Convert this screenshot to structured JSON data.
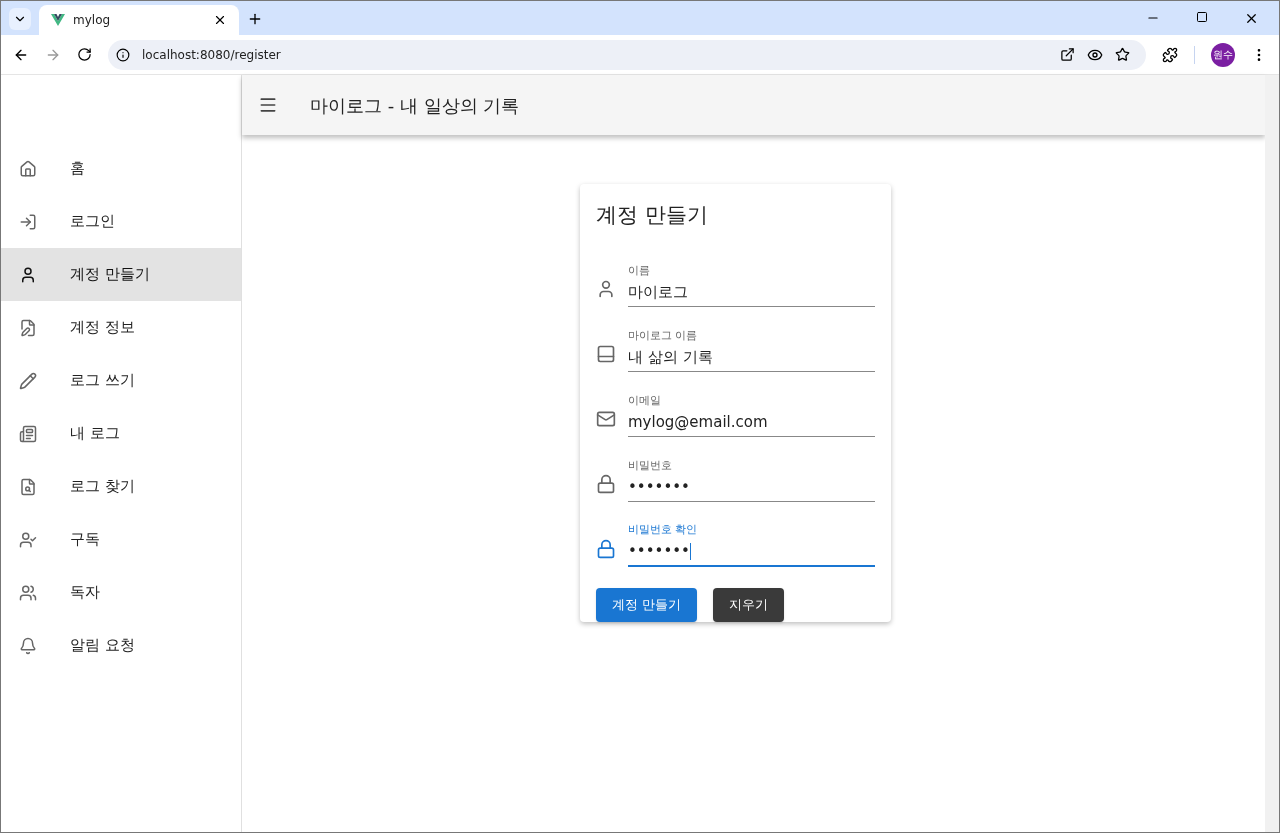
{
  "browser": {
    "tab": {
      "title": "mylog"
    },
    "url": "localhost:8080/register",
    "profile": "원수"
  },
  "app_bar": {
    "title": "마이로그 - 내 일상의 기록"
  },
  "sidebar": {
    "items": [
      {
        "label": "홈",
        "selected": false
      },
      {
        "label": "로그인",
        "selected": false
      },
      {
        "label": "계정 만들기",
        "selected": true
      },
      {
        "label": "계정 정보",
        "selected": false
      },
      {
        "label": "로그 쓰기",
        "selected": false
      },
      {
        "label": "내 로그",
        "selected": false
      },
      {
        "label": "로그 찾기",
        "selected": false
      },
      {
        "label": "구독",
        "selected": false
      },
      {
        "label": "독자",
        "selected": false
      },
      {
        "label": "알림 요청",
        "selected": false
      }
    ]
  },
  "form": {
    "title": "계정 만들기",
    "fields": [
      {
        "label": "이름",
        "value": "마이로그",
        "focused": false
      },
      {
        "label": "마이로그 이름",
        "value": "내 삶의 기록",
        "focused": false
      },
      {
        "label": "이메일",
        "value": "mylog@email.com",
        "focused": false
      },
      {
        "label": "비밀번호",
        "value": "•••••••",
        "focused": false
      },
      {
        "label": "비밀번호 확인",
        "value": "•••••••",
        "focused": true
      }
    ],
    "buttons": [
      {
        "label": "계정 만들기",
        "kind": "primary"
      },
      {
        "label": "지우기",
        "kind": "secondary"
      }
    ]
  }
}
